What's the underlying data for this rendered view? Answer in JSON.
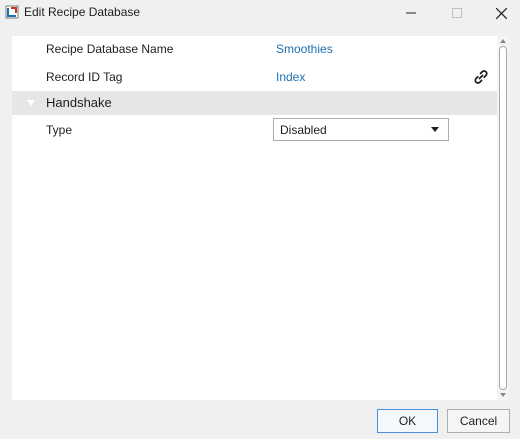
{
  "window": {
    "title": "Edit Recipe Database",
    "app_icon": "recipe-app-icon",
    "controls": {
      "minimize": "minimize-icon",
      "maximize": "maximize-icon",
      "close": "close-icon"
    }
  },
  "properties": {
    "name": {
      "label": "Recipe Database Name",
      "value": "Smoothies"
    },
    "record_tag": {
      "label": "Record ID Tag",
      "value": "Index",
      "icon": "link-icon"
    }
  },
  "handshake": {
    "title": "Handshake",
    "expanded": true,
    "type": {
      "label": "Type",
      "selected": "Disabled"
    }
  },
  "buttons": {
    "ok": "OK",
    "cancel": "Cancel"
  },
  "colors": {
    "link_value": "#1b6fb0",
    "group_header": "#e6e6e6",
    "ok_border": "#4a90d9"
  }
}
